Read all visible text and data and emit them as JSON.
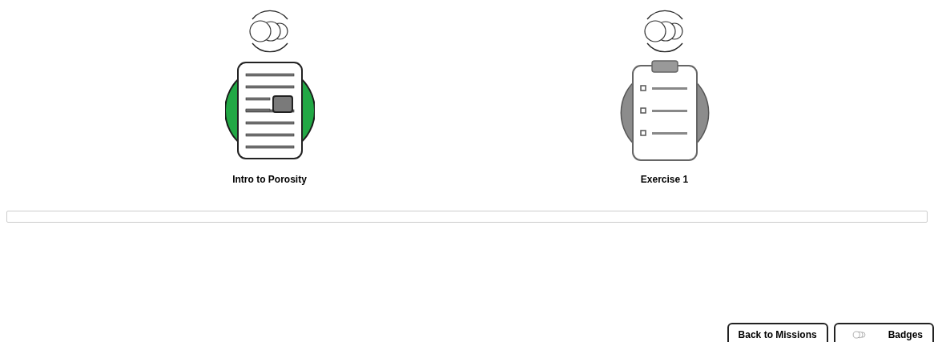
{
  "missions": [
    {
      "kind": "reading",
      "title": "Intro to Porosity",
      "completed": true
    },
    {
      "kind": "exercise",
      "title": "Exercise 1",
      "completed": false
    }
  ],
  "buttons": [
    {
      "kind": "back",
      "label": "Back to Missions"
    },
    {
      "kind": "badges",
      "label": "Badges"
    }
  ]
}
